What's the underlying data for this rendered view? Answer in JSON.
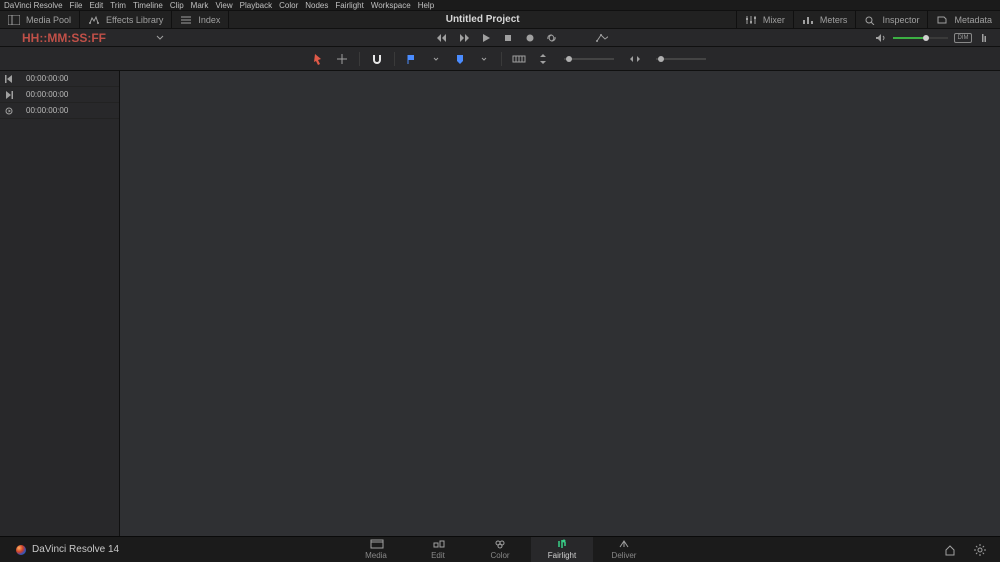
{
  "menu": [
    "DaVinci Resolve",
    "File",
    "Edit",
    "Trim",
    "Timeline",
    "Clip",
    "Mark",
    "View",
    "Playback",
    "Color",
    "Nodes",
    "Fairlight",
    "Workspace",
    "Help"
  ],
  "toolbar": {
    "left": [
      {
        "name": "media-pool",
        "label": "Media Pool"
      },
      {
        "name": "effects-library",
        "label": "Effects Library"
      },
      {
        "name": "index",
        "label": "Index"
      }
    ],
    "title": "Untitled Project",
    "right": [
      {
        "name": "mixer",
        "label": "Mixer"
      },
      {
        "name": "meters",
        "label": "Meters"
      },
      {
        "name": "inspector",
        "label": "Inspector"
      },
      {
        "name": "metadata",
        "label": "Metadata"
      }
    ]
  },
  "timecode_title": "HH::MM:SS:FF",
  "left_rows": [
    {
      "icon": "start",
      "tc": "00:00:00:00"
    },
    {
      "icon": "end",
      "tc": "00:00:00:00"
    },
    {
      "icon": "play",
      "tc": "00:00:00:00"
    }
  ],
  "volume_percent": 55,
  "tabs": [
    {
      "name": "media",
      "label": "Media"
    },
    {
      "name": "edit",
      "label": "Edit"
    },
    {
      "name": "color",
      "label": "Color"
    },
    {
      "name": "fairlight",
      "label": "Fairlight",
      "active": true,
      "accent": "#38d088"
    },
    {
      "name": "deliver",
      "label": "Deliver"
    }
  ],
  "brand": "DaVinci Resolve 14",
  "dim_label": "DIM"
}
